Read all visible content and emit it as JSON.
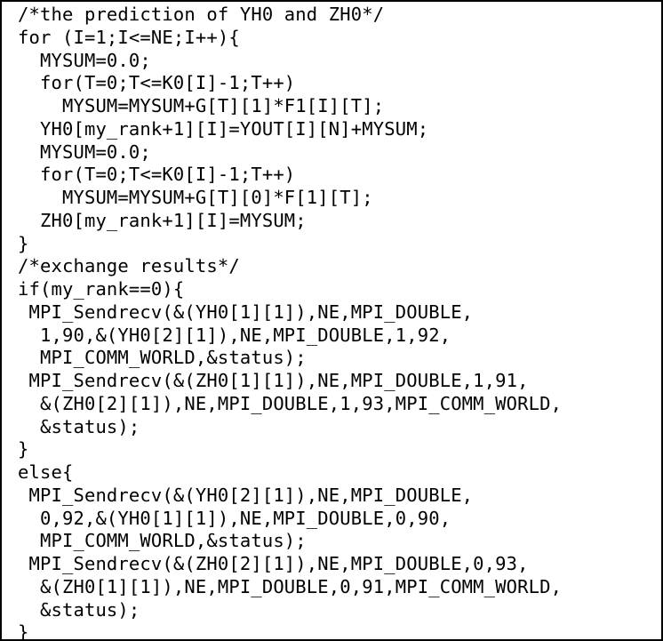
{
  "code": {
    "lines": [
      "/*the prediction of YH0 and ZH0*/",
      "for (I=1;I<=NE;I++){",
      "  MYSUM=0.0;",
      "  for(T=0;T<=K0[I]-1;T++)",
      "    MYSUM=MYSUM+G[T][1]*F1[I][T];",
      "  YH0[my_rank+1][I]=YOUT[I][N]+MYSUM;",
      "  MYSUM=0.0;",
      "  for(T=0;T<=K0[I]-1;T++)",
      "    MYSUM=MYSUM+G[T][0]*F[1][T];",
      "  ZH0[my_rank+1][I]=MYSUM;",
      "}",
      "/*exchange results*/",
      "if(my_rank==0){",
      " MPI_Sendrecv(&(YH0[1][1]),NE,MPI_DOUBLE,",
      "  1,90,&(YH0[2][1]),NE,MPI_DOUBLE,1,92,",
      "  MPI_COMM_WORLD,&status);",
      " MPI_Sendrecv(&(ZH0[1][1]),NE,MPI_DOUBLE,1,91,",
      "  &(ZH0[2][1]),NE,MPI_DOUBLE,1,93,MPI_COMM_WORLD,",
      "  &status);",
      "}",
      "else{",
      " MPI_Sendrecv(&(YH0[2][1]),NE,MPI_DOUBLE,",
      "  0,92,&(YH0[1][1]),NE,MPI_DOUBLE,0,90,",
      "  MPI_COMM_WORLD,&status);",
      " MPI_Sendrecv(&(ZH0[2][1]),NE,MPI_DOUBLE,0,93,",
      "  &(ZH0[1][1]),NE,MPI_DOUBLE,0,91,MPI_COMM_WORLD,",
      "  &status);",
      "}"
    ]
  }
}
